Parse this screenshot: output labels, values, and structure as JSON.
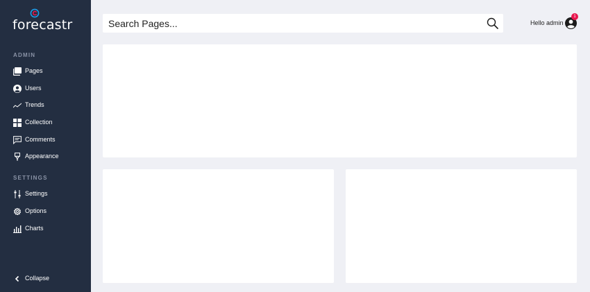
{
  "brand": {
    "name": "forecastr",
    "accent_color": "#e8174f",
    "ring_color": "#1f9ce8"
  },
  "sidebar": {
    "sections": [
      {
        "title": "ADMIN",
        "items": [
          {
            "label": "Pages",
            "icon": "pages-icon"
          },
          {
            "label": "Users",
            "icon": "user-icon"
          },
          {
            "label": "Trends",
            "icon": "trend-icon"
          },
          {
            "label": "Collection",
            "icon": "grid-icon"
          },
          {
            "label": "Comments",
            "icon": "comment-icon"
          },
          {
            "label": "Appearance",
            "icon": "brush-icon"
          }
        ]
      },
      {
        "title": "SETTINGS",
        "items": [
          {
            "label": "Settings",
            "icon": "sliders-icon"
          },
          {
            "label": "Options",
            "icon": "gear-icon"
          },
          {
            "label": "Charts",
            "icon": "bar-chart-icon"
          }
        ]
      }
    ],
    "collapse_label": "Collapse"
  },
  "header": {
    "search_placeholder": "Search Pages...",
    "greeting": "Hello admin",
    "notification_count": "1"
  }
}
